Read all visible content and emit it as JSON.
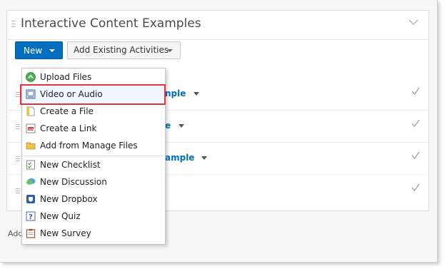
{
  "module": {
    "title": "Interactive Content Examples"
  },
  "toolbar": {
    "new_label": "New",
    "add_existing_label": "Add Existing Activities"
  },
  "rows": [
    {
      "visible_title": "nple"
    },
    {
      "visible_title": "e"
    },
    {
      "visible_title": "ample"
    },
    {
      "visible_title": ""
    }
  ],
  "footer": {
    "add_text": "Add"
  },
  "new_menu": {
    "items": [
      {
        "label": "Upload Files",
        "icon": "upload-icon"
      },
      {
        "label": "Video or Audio",
        "icon": "video-icon"
      },
      {
        "label": "Create a File",
        "icon": "file-icon"
      },
      {
        "label": "Create a Link",
        "icon": "link-icon"
      },
      {
        "label": "Add from Manage Files",
        "icon": "folder-icon"
      },
      {
        "label": "New Checklist",
        "icon": "checklist-icon"
      },
      {
        "label": "New Discussion",
        "icon": "discussion-icon"
      },
      {
        "label": "New Dropbox",
        "icon": "dropbox-icon"
      },
      {
        "label": "New Quiz",
        "icon": "quiz-icon"
      },
      {
        "label": "New Survey",
        "icon": "survey-icon"
      }
    ],
    "highlighted_item": "Video or Audio"
  },
  "colors": {
    "primary_button": "#006fbf",
    "highlight_border": "#e2343f",
    "link_text": "#006fbf"
  }
}
